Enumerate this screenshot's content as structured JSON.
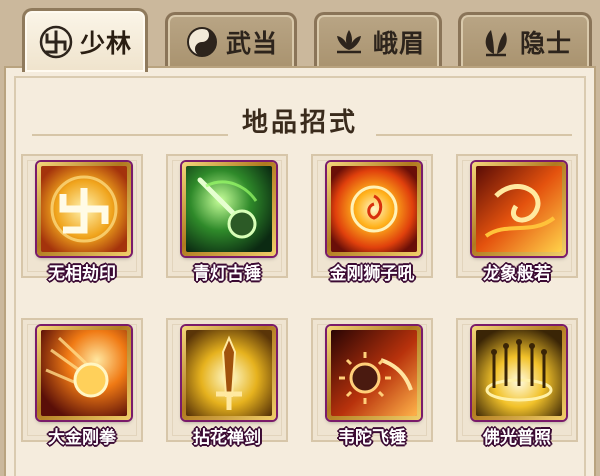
{
  "tabs": [
    {
      "label": "少林",
      "icon": "swastika-icon",
      "active": true
    },
    {
      "label": "武当",
      "icon": "yin-yang-icon",
      "active": false
    },
    {
      "label": "峨眉",
      "icon": "lotus-icon",
      "active": false
    },
    {
      "label": "隐士",
      "icon": "leaf-icon",
      "active": false
    }
  ],
  "section": {
    "title": "地品招式"
  },
  "skills": [
    {
      "name": "无相劫印",
      "icon": "golden-swastika-seal-icon"
    },
    {
      "name": "青灯古锤",
      "icon": "green-lantern-mace-icon"
    },
    {
      "name": "金刚狮子吼",
      "icon": "flaming-lion-roar-icon"
    },
    {
      "name": "龙象般若",
      "icon": "fire-dragon-icon"
    },
    {
      "name": "大金刚拳",
      "icon": "flaming-fist-icon"
    },
    {
      "name": "拈花禅剑",
      "icon": "golden-sword-icon"
    },
    {
      "name": "韦陀飞锤",
      "icon": "spiked-flying-hammer-icon"
    },
    {
      "name": "佛光普照",
      "icon": "buddha-light-icon"
    }
  ],
  "colors": {
    "panel_bg": "#f5ecdd",
    "tab_active_bg": "#fbf5e8",
    "tab_inactive_bg": "#b9a585",
    "icon_frame_gold": "#f4d77b",
    "icon_frame_purple": "#8a2c88",
    "skill_name_outline": "#3b0a33"
  }
}
